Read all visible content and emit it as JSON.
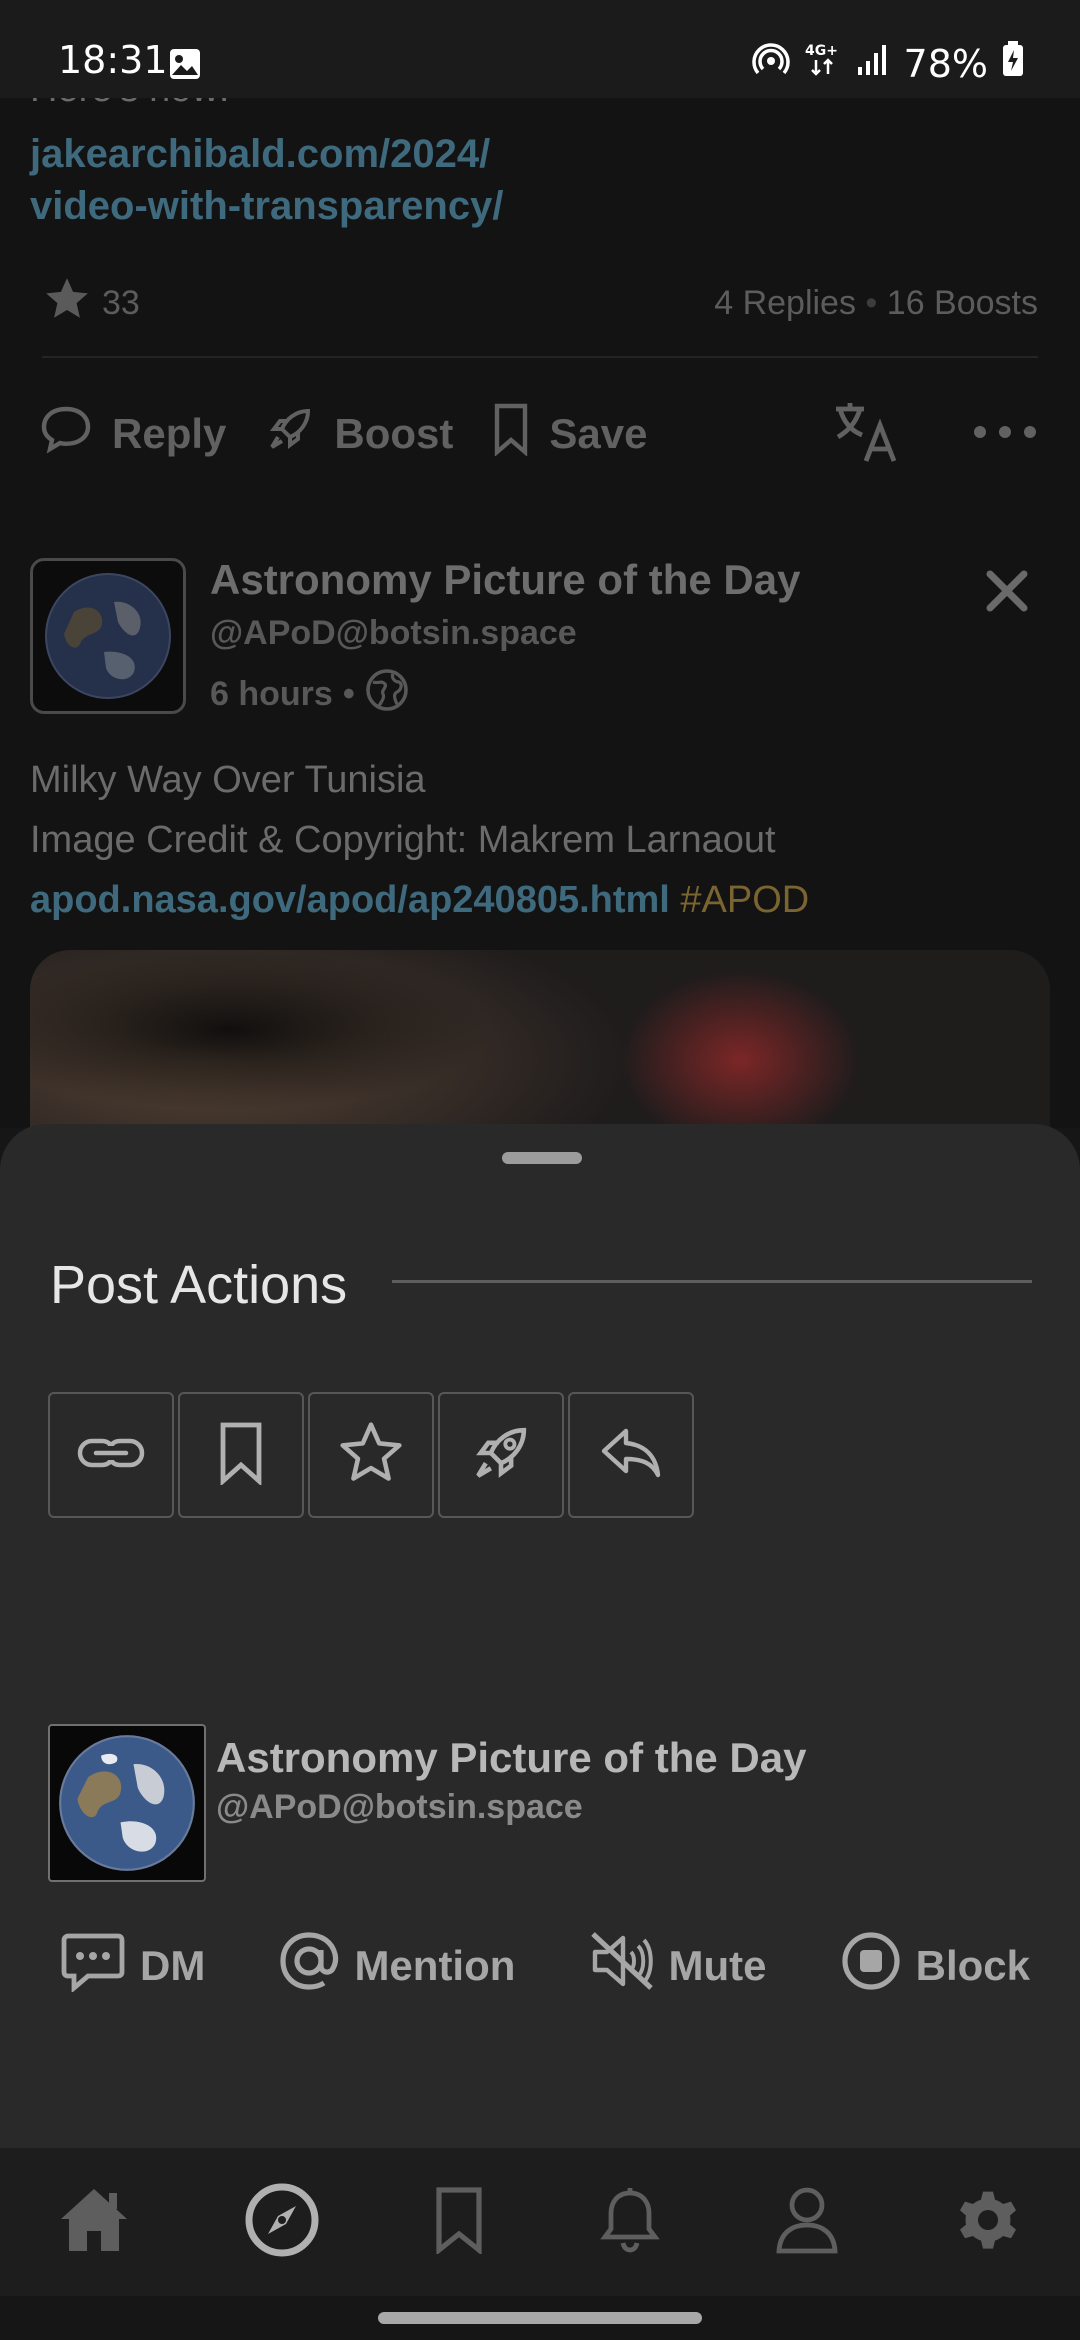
{
  "status_bar": {
    "time": "18:31",
    "battery": "78%"
  },
  "feed": {
    "prev_post": {
      "partial_text": "Here's how:",
      "link_line1": "jakearchibald.com/2024/",
      "link_line2": "video-with-transparency/",
      "favourites": "33",
      "replies": "4 Replies",
      "boosts": "16 Boosts",
      "reply_label": "Reply",
      "boost_label": "Boost",
      "save_label": "Save"
    },
    "post": {
      "display_name": "Astronomy Picture of the Day",
      "handle": "@APoD@botsin.space",
      "time": "6 hours",
      "body_line1": "Milky Way Over Tunisia",
      "body_line2": "Image Credit & Copyright: Makrem Larnaout",
      "link": "apod.nasa.gov/apod/ap240805.html",
      "hashtag": "#APOD"
    }
  },
  "sheet": {
    "title": "Post Actions",
    "account": {
      "display_name": "Astronomy Picture of the Day",
      "handle": "@APoD@botsin.space"
    },
    "actions": {
      "dm": "DM",
      "mention": "Mention",
      "mute": "Mute",
      "block": "Block"
    }
  },
  "colors": {
    "sheet_bg": "#292929",
    "link": "#3f6a7e",
    "hashtag": "#7a6430",
    "feed_bg": "#131313"
  }
}
